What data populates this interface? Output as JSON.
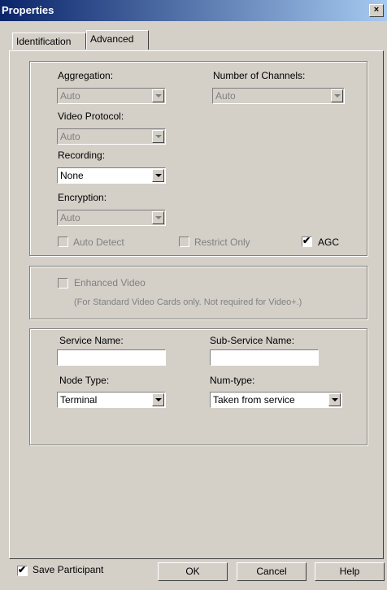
{
  "window": {
    "title": "Properties",
    "close_glyph": "×"
  },
  "tabs": [
    {
      "label": "Identification"
    },
    {
      "label": "Advanced"
    }
  ],
  "advanced": {
    "aggregation": {
      "label": "Aggregation:",
      "value": "Auto"
    },
    "num_channels": {
      "label": "Number of Channels:",
      "value": "Auto"
    },
    "video_protocol": {
      "label": "Video Protocol:",
      "value": "Auto"
    },
    "recording": {
      "label": "Recording:",
      "value": "None"
    },
    "encryption": {
      "label": "Encryption:",
      "value": "Auto"
    },
    "auto_detect": {
      "label": "Auto Detect",
      "checked": false
    },
    "restrict_only": {
      "label": "Restrict Only",
      "checked": false
    },
    "agc": {
      "label": "AGC",
      "checked": true
    },
    "enhanced_video": {
      "label": "Enhanced Video",
      "checked": false,
      "note": "(For Standard Video Cards only. Not required for Video+.)"
    },
    "service_name": {
      "label": "Service Name:",
      "value": ""
    },
    "sub_service_name": {
      "label": "Sub-Service Name:",
      "value": ""
    },
    "node_type": {
      "label": "Node Type:",
      "value": "Terminal"
    },
    "num_type": {
      "label": "Num-type:",
      "value": "Taken from service"
    }
  },
  "footer": {
    "save_participant": {
      "label": "Save Participant",
      "checked": true
    },
    "ok_label": "OK",
    "cancel_label": "Cancel",
    "help_label": "Help"
  },
  "check_glyph": "✔"
}
